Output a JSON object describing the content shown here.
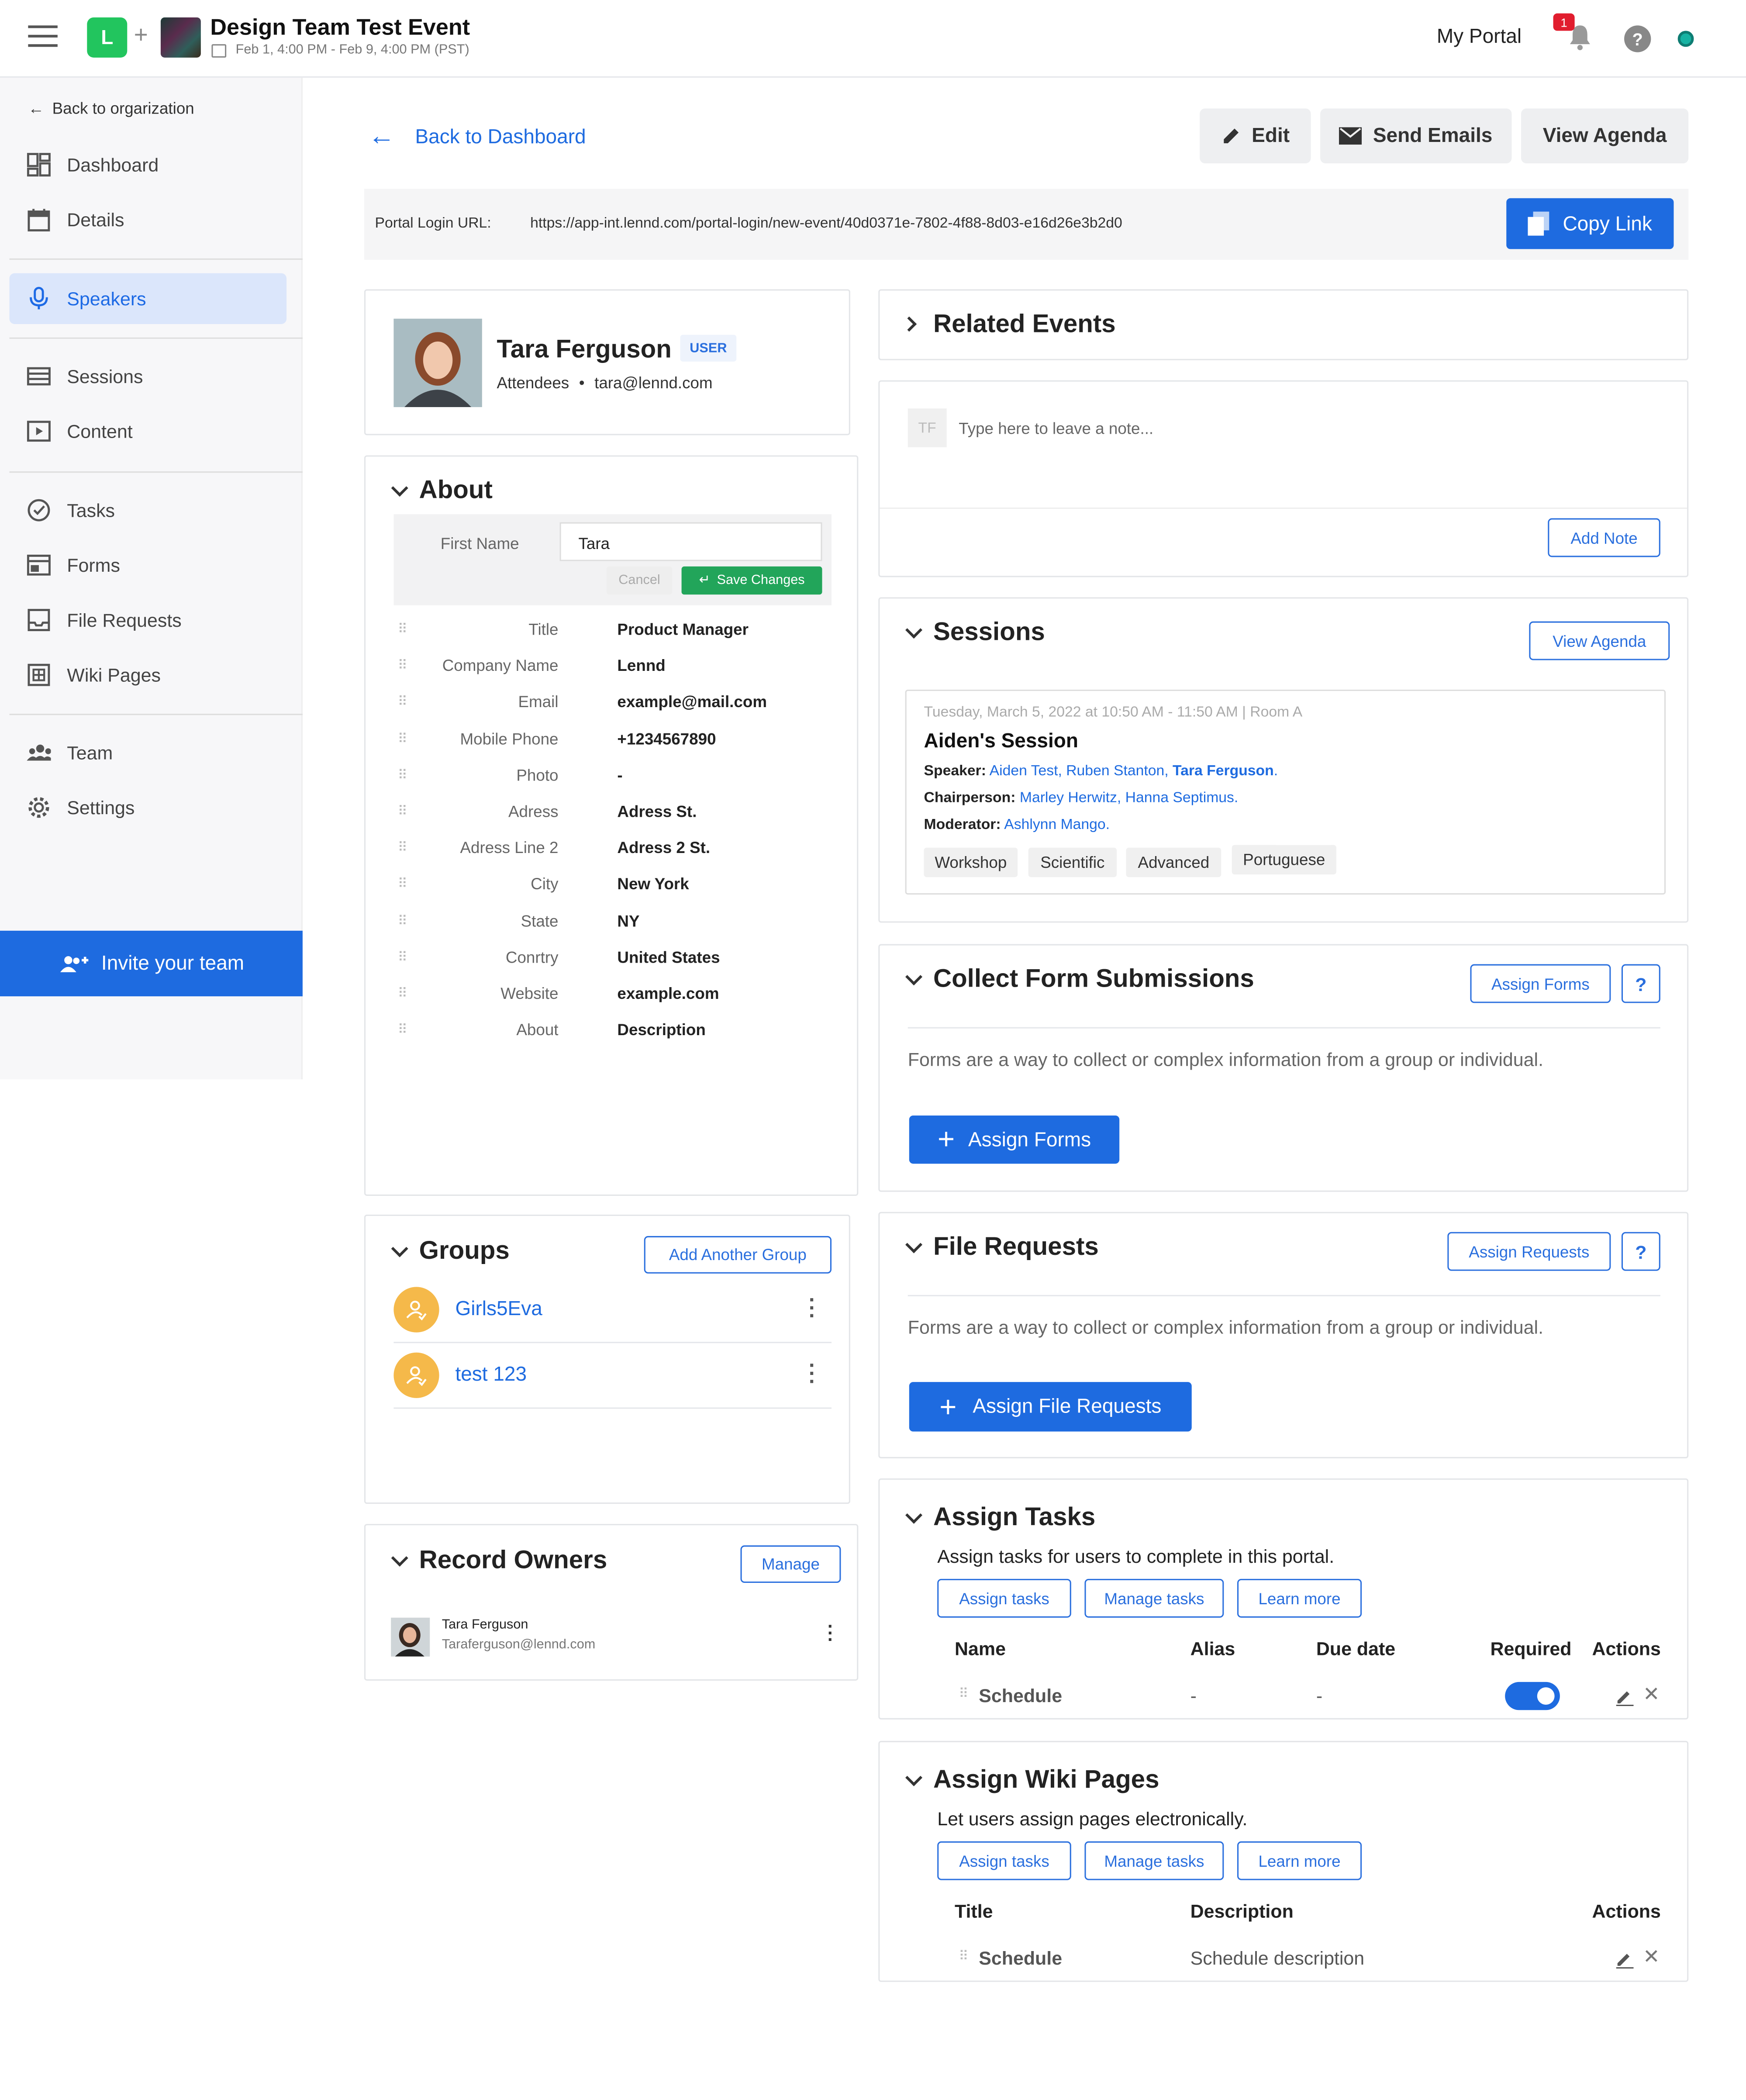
{
  "header": {
    "logo_letter": "L",
    "plus": "+",
    "event_title": "Design Team Test Event",
    "event_dates": "Feb 1, 4:00 PM - Feb 9, 4:00 PM (PST)",
    "my_portal": "My Portal",
    "notification_count": "1",
    "help": "?"
  },
  "sidebar": {
    "back_label": "Back to orgarization",
    "items": [
      {
        "label": "Dashboard",
        "icon": "dashboard-icon"
      },
      {
        "label": "Details",
        "icon": "calendar-icon"
      },
      {
        "label": "Speakers",
        "icon": "microphone-icon"
      },
      {
        "label": "Sessions",
        "icon": "sessions-icon"
      },
      {
        "label": "Content",
        "icon": "play-icon"
      },
      {
        "label": "Tasks",
        "icon": "check-circle-icon"
      },
      {
        "label": "Forms",
        "icon": "forms-icon"
      },
      {
        "label": "File Requests",
        "icon": "inbox-icon"
      },
      {
        "label": "Wiki Pages",
        "icon": "wiki-icon"
      },
      {
        "label": "Team",
        "icon": "team-icon"
      },
      {
        "label": "Settings",
        "icon": "gear-icon"
      }
    ],
    "invite_label": "Invite your team"
  },
  "toolbar": {
    "back_dashboard": "Back to Dashboard",
    "edit": "Edit",
    "send_emails": "Send Emails",
    "view_agenda": "View Agenda"
  },
  "portal": {
    "label": "Portal Login URL:",
    "url": "https://app-int.lennd.com/portal-login/new-event/40d0371e-7802-4f88-8d03-e16d26e3b2d0",
    "copy_link": "Copy Link"
  },
  "profile": {
    "name": "Tara Ferguson",
    "badge": "USER",
    "group": "Attendees",
    "bullet": "•",
    "email": "tara@lennd.com"
  },
  "about": {
    "title": "About",
    "edit_label": "First Name",
    "edit_value": "Tara",
    "cancel": "Cancel",
    "save": "Save Changes",
    "fields": [
      {
        "label": "Title",
        "value": "Product Manager"
      },
      {
        "label": "Company Name",
        "value": "Lennd"
      },
      {
        "label": "Email",
        "value": "example@mail.com"
      },
      {
        "label": "Mobile Phone",
        "value": "+1234567890"
      },
      {
        "label": "Photo",
        "value": "-"
      },
      {
        "label": "Adress",
        "value": "Adress St."
      },
      {
        "label": "Adress Line 2",
        "value": "Adress 2 St."
      },
      {
        "label": "City",
        "value": "New York"
      },
      {
        "label": "State",
        "value": "NY"
      },
      {
        "label": "Conrtry",
        "value": "United States"
      },
      {
        "label": "Website",
        "value": "example.com"
      },
      {
        "label": "About",
        "value": "Description"
      }
    ]
  },
  "groups": {
    "title": "Groups",
    "add_button": "Add Another Group",
    "items": [
      {
        "name": "Girls5Eva"
      },
      {
        "name": "test 123"
      }
    ]
  },
  "record_owners": {
    "title": "Record Owners",
    "manage": "Manage",
    "owner_name": "Tara Ferguson",
    "owner_email": "Taraferguson@lennd.com"
  },
  "related_events": {
    "title": "Related Events"
  },
  "note": {
    "initials": "TF",
    "placeholder": "Type here to leave a note...",
    "add_note": "Add Note"
  },
  "sessions": {
    "title": "Sessions",
    "view_agenda": "View Agenda",
    "session": {
      "datetime": "Tuesday, March 5, 2022 at 10:50 AM - 11:50 AM | Room A",
      "name": "Aiden's Session",
      "speaker_label": "Speaker:",
      "speakers": "Aiden Test, Ruben Stanton,",
      "speaker_bold": "Tara Ferguson",
      "speaker_end": ".",
      "chair_label": "Chairperson:",
      "chair": "Marley Herwitz, Hanna Septimus.",
      "moderator_label": "Moderator:",
      "moderator": "Ashlynn Mango.",
      "tags": [
        "Workshop",
        "Scientific",
        "Advanced",
        "Portuguese"
      ]
    }
  },
  "forms_section": {
    "title": "Collect Form Submissions",
    "assign_btn": "Assign Forms",
    "help": "?",
    "description": "Forms are a way to collect or complex information from a group or individual.",
    "primary_btn": "Assign Forms"
  },
  "file_requests": {
    "title": "File Requests",
    "assign_btn": "Assign Requests",
    "help": "?",
    "description": "Forms are a way to collect or complex information from a group or individual.",
    "primary_btn": "Assign File Requests"
  },
  "tasks": {
    "title": "Assign Tasks",
    "description": "Assign tasks for users to complete in this portal.",
    "btn_assign": "Assign tasks",
    "btn_manage": "Manage tasks",
    "btn_learn": "Learn more",
    "columns": [
      "Name",
      "Alias",
      "Due date",
      "Required",
      "Actions"
    ],
    "row": {
      "name": "Schedule",
      "alias": "-",
      "due": "-",
      "required": true
    }
  },
  "wiki": {
    "title": "Assign Wiki Pages",
    "description": "Let users assign pages electronically.",
    "btn_assign": "Assign tasks",
    "btn_manage": "Manage tasks",
    "btn_learn": "Learn more",
    "columns": [
      "Title",
      "Description",
      "Actions"
    ],
    "row": {
      "title": "Schedule",
      "description": "Schedule description"
    }
  },
  "colors": {
    "accent": "#1e6be0",
    "success": "#22a55a",
    "group_avatar": "#f5b94a",
    "status_dot": "#17b3a3"
  }
}
